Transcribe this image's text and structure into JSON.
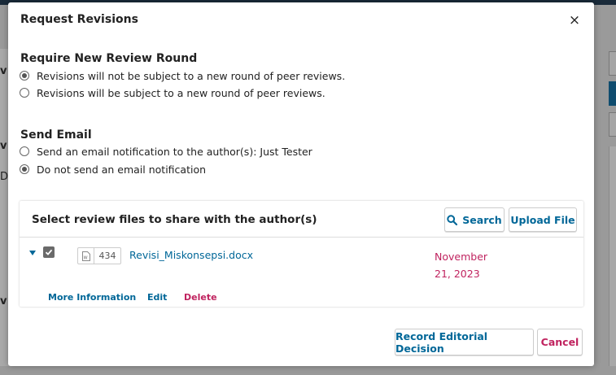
{
  "background": {
    "fragments": [
      "v",
      "v",
      "Do",
      "v"
    ]
  },
  "modal": {
    "title": "Request Revisions",
    "close_label": "×"
  },
  "review_round": {
    "heading": "Require New Review Round",
    "options": [
      {
        "label": "Revisions will not be subject to a new round of peer reviews.",
        "checked": true
      },
      {
        "label": "Revisions will be subject to a new round of peer reviews.",
        "checked": false
      }
    ]
  },
  "send_email": {
    "heading": "Send Email",
    "options": [
      {
        "label": "Send an email notification to the author(s): Just Tester",
        "checked": false
      },
      {
        "label": "Do not send an email notification",
        "checked": true
      }
    ]
  },
  "files_grid": {
    "title": "Select review files to share with the author(s)",
    "search_label": "Search",
    "upload_label": "Upload File",
    "rows": [
      {
        "file_id": "434",
        "file_name": "Revisi_Miskonsepsi.docx",
        "date": "November 21, 2023",
        "selected": true,
        "actions": {
          "more_info": "More Information",
          "edit": "Edit",
          "delete": "Delete"
        }
      }
    ]
  },
  "footer": {
    "record_label": "Record Editorial Decision",
    "cancel_label": "Cancel"
  },
  "colors": {
    "link_blue": "#006798",
    "danger_red": "#c0235f",
    "overlay_gray": "#9a9a9a"
  }
}
